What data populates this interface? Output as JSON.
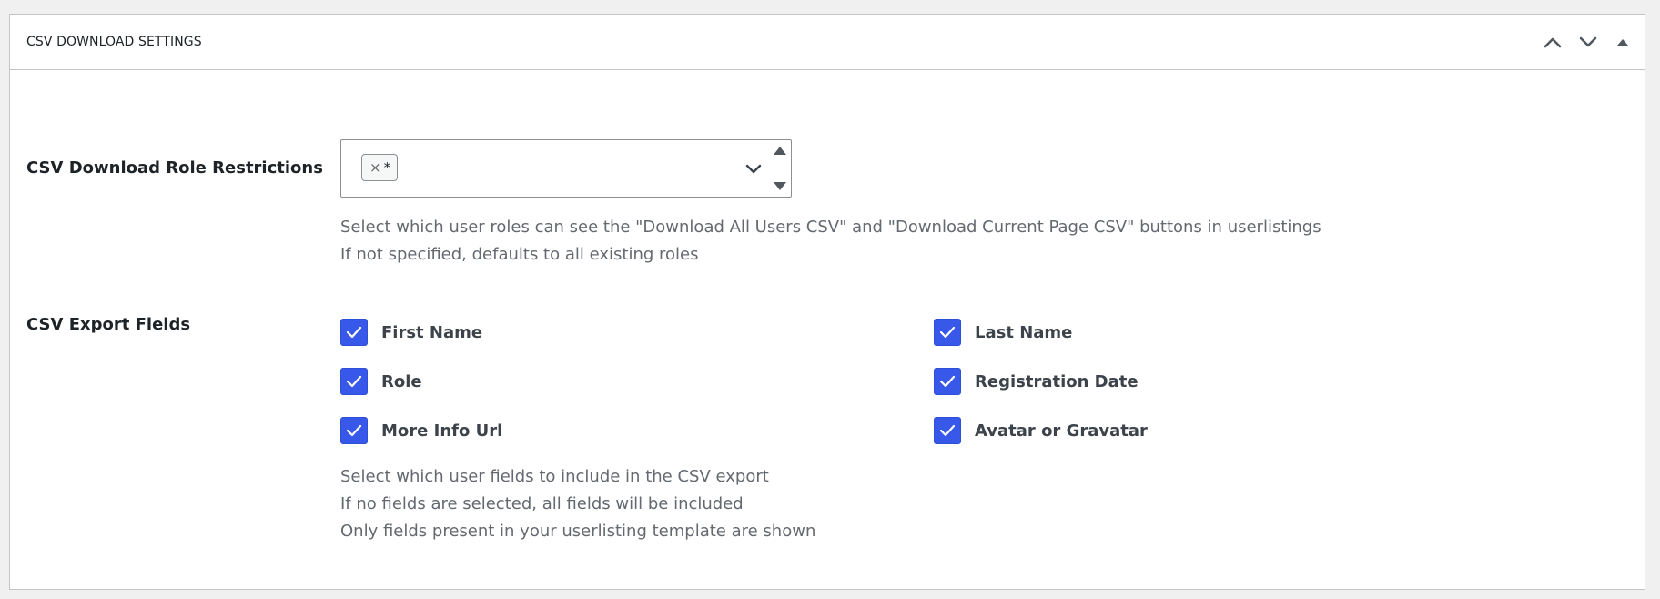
{
  "panel": {
    "title": "CSV DOWNLOAD SETTINGS"
  },
  "role_restrictions": {
    "label": "CSV Download Role Restrictions",
    "selected_tags": [
      {
        "remove": "×",
        "value": "*"
      }
    ],
    "help": [
      "Select which user roles can see the \"Download All Users CSV\" and \"Download Current Page CSV\" buttons in userlistings",
      "If not specified, defaults to all existing roles"
    ]
  },
  "export_fields": {
    "label": "CSV Export Fields",
    "fields": [
      {
        "label": "First Name",
        "checked": true
      },
      {
        "label": "Last Name",
        "checked": true
      },
      {
        "label": "Role",
        "checked": true
      },
      {
        "label": "Registration Date",
        "checked": true
      },
      {
        "label": "More Info Url",
        "checked": true
      },
      {
        "label": "Avatar or Gravatar",
        "checked": true
      }
    ],
    "help": [
      "Select which user fields to include in the CSV export",
      "If no fields are selected, all fields will be included",
      "Only fields present in your userlisting template are shown"
    ]
  },
  "icons": {
    "move_up": "chevron-up-icon",
    "move_down": "chevron-down-icon",
    "toggle": "triangle-up-icon",
    "select_open": "chevron-down-icon",
    "check": "checkmark-icon"
  },
  "colors": {
    "checkbox": "#3858e9",
    "help_text": "#646970",
    "border": "#c3c4c7"
  }
}
